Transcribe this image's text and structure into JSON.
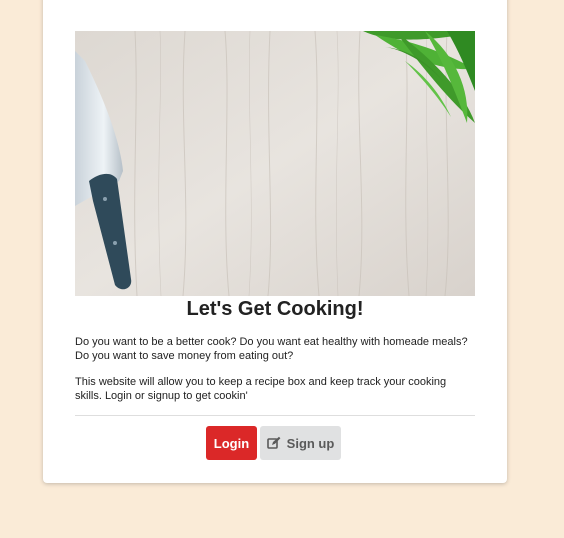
{
  "card": {
    "title": "Let's Get Cooking!",
    "paragraphs": [
      "Do you want to be a better cook? Do you want eat healthy with homeade meals? Do you want to save money from eating out?",
      "This website will allow you to keep a recipe box and keep track your cooking skills. Login or signup to get cookin'"
    ]
  },
  "buttons": {
    "login_label": "Login",
    "signup_label": "Sign up",
    "signup_icon": "edit-icon"
  },
  "colors": {
    "page_background": "#faebd7",
    "login_button": "#db2828",
    "signup_button": "#e0e1e2"
  }
}
